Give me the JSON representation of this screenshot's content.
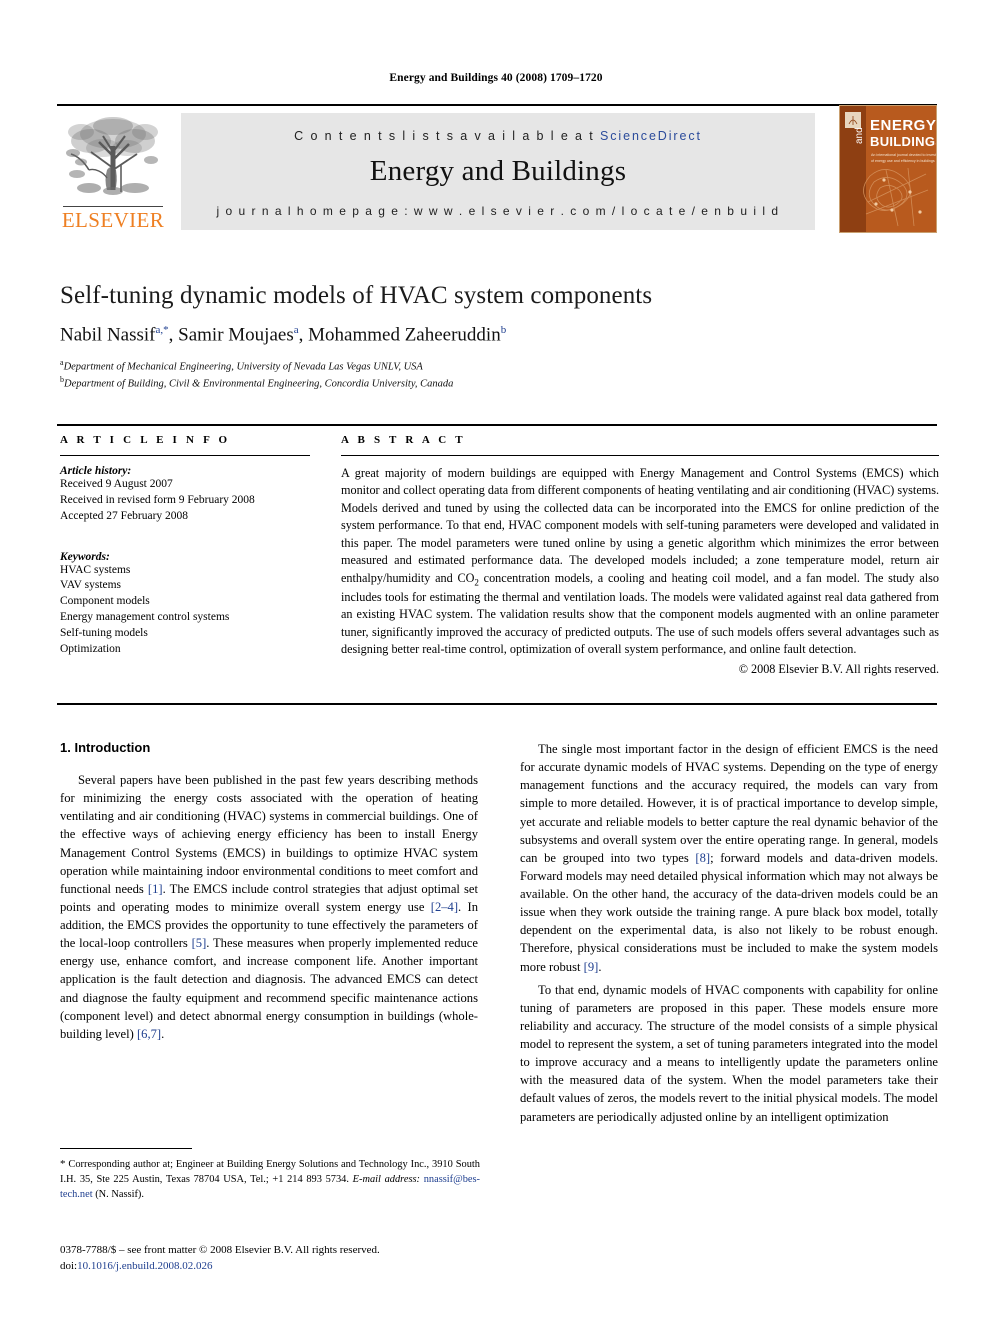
{
  "running_head": "Energy and Buildings 40 (2008) 1709–1720",
  "masthead": {
    "contents_prefix": "C o n t e n t s   l i s t s   a v a i l a b l e   a t",
    "sciencedirect": "ScienceDirect",
    "journal_title": "Energy and Buildings",
    "homepage": "j o u r n a l   h o m e p a g e :   w w w . e l s e v i e r . c o m / l o c a t e / e n b u i l d",
    "publisher": "ELSEVIER",
    "cover": {
      "line1": "ENERGY",
      "line2": "and",
      "line3": "BUILDINGS",
      "subtitle": "An international journal devoted to investigations of energy use and efficiency in buildings",
      "bg_color": "#b85a1e",
      "panel_color": "#8a3d12"
    }
  },
  "article": {
    "title": "Self-tuning dynamic models of HVAC system components",
    "authors": [
      {
        "name": "Nabil Nassif",
        "marks": "a,*"
      },
      {
        "name": "Samir Moujaes",
        "marks": "a"
      },
      {
        "name": "Mohammed Zaheeruddin",
        "marks": "b"
      }
    ],
    "affiliations": [
      {
        "mark": "a",
        "text": "Department of Mechanical Engineering, University of Nevada Las Vegas UNLV, USA"
      },
      {
        "mark": "b",
        "text": "Department of Building, Civil & Environmental Engineering, Concordia University, Canada"
      }
    ]
  },
  "info": {
    "heading": "A R T I C L E   I N F O",
    "history_label": "Article history:",
    "history": [
      "Received 9 August 2007",
      "Received in revised form 9 February 2008",
      "Accepted 27 February 2008"
    ],
    "keywords_label": "Keywords:",
    "keywords": [
      "HVAC systems",
      "VAV systems",
      "Component models",
      "Energy management control systems",
      "Self-tuning models",
      "Optimization"
    ]
  },
  "abstract": {
    "heading": "A B S T R A C T",
    "part1": "A great majority of modern buildings are equipped with Energy Management and Control Systems (EMCS) which monitor and collect operating data from different components of heating ventilating and air conditioning (HVAC) systems. Models derived and tuned by using the collected data can be incorporated into the EMCS for online prediction of the system performance. To that end, HVAC component models with self-tuning parameters were developed and validated in this paper. The model parameters were tuned online by using a genetic algorithm which minimizes the error between measured and estimated performance data. The developed models included; a zone temperature model, return air enthalpy/humidity and CO",
    "subscript": "2",
    "part2": " concentration models, a cooling and heating coil model, and a fan model. The study also includes tools for estimating the thermal and ventilation loads. The models were validated against real data gathered from an existing HVAC system. The validation results show that the component models augmented with an online parameter tuner, significantly improved the accuracy of predicted outputs. The use of such models offers several advantages such as designing better real-time control, optimization of overall system performance, and online fault detection.",
    "copyright": "© 2008 Elsevier B.V. All rights reserved."
  },
  "body": {
    "section_heading": "1.  Introduction",
    "left_p1_a": "Several papers have been published in the past few years describing methods for minimizing the energy costs associated with the operation of heating ventilating and air conditioning (HVAC) systems in commercial buildings. One of the effective ways of achieving energy efficiency has been to install Energy Management Control Systems (EMCS) in buildings to optimize HVAC system operation while maintaining indoor environmental conditions to meet comfort and functional needs ",
    "ref1": "[1]",
    "left_p1_b": ". The EMCS include control strategies that adjust optimal set points and operating modes to minimize overall system energy use ",
    "ref2": "[2–4]",
    "left_p1_c": ". In addition, the EMCS provides the opportunity to tune effectively the parameters of the local-loop controllers ",
    "ref3": "[5]",
    "left_p1_d": ". These measures when properly implemented reduce energy use, enhance comfort, and increase component life. Another important application is the fault detection and diagnosis. The advanced EMCS can detect and diagnose the faulty equipment and recommend specific maintenance actions (component level) and detect abnormal energy consumption in buildings (whole-building level) ",
    "ref4": "[6,7]",
    "left_p1_e": ".",
    "right_p1_a": "The single most important factor in the design of efficient EMCS is the need for accurate dynamic models of HVAC systems. Depending on the type of energy management functions and the accuracy required, the models can vary from simple to more detailed. However, it is of practical importance to develop simple, yet accurate and reliable models to better capture the real dynamic behavior of the subsystems and overall system over the entire operating range. In general, models can be grouped into two types ",
    "ref5": "[8]",
    "right_p1_b": "; forward models and data-driven models. Forward models may need detailed physical information which may not always be available. On the other hand, the accuracy of the data-driven models could be an issue when they work outside the training range. A pure black box model, totally dependent on the experimental data, is also not likely to be robust enough. Therefore, physical considerations must be included to make the system models more robust ",
    "ref6": "[9]",
    "right_p1_c": ".",
    "right_p2": "To that end, dynamic models of HVAC components with capability for online tuning of parameters are proposed in this paper. These models ensure more reliability and accuracy. The structure of the model consists of a simple physical model to represent the system, a set of tuning parameters integrated into the model to improve accuracy and a means to intelligently update the parameters online with the measured data of the system. When the model parameters take their default values of zeros, the models revert to the initial physical models. The model parameters are periodically adjusted online by an intelligent optimization"
  },
  "footnote": {
    "star": "*",
    "text_a": " Corresponding author at; Engineer at Building Energy Solutions and Technology Inc., 3910 South I.H. 35, Ste 225 Austin, Texas 78704 USA, Tel.; +1 214 893 5734.",
    "email_label": "E-mail address:",
    "email": "nnassif@bes-tech.net",
    "email_suffix": " (N. Nassif)."
  },
  "imprint": {
    "line1": "0378-7788/$ – see front matter © 2008 Elsevier B.V. All rights reserved.",
    "doi_label": "doi:",
    "doi": "10.1016/j.enbuild.2008.02.026"
  }
}
